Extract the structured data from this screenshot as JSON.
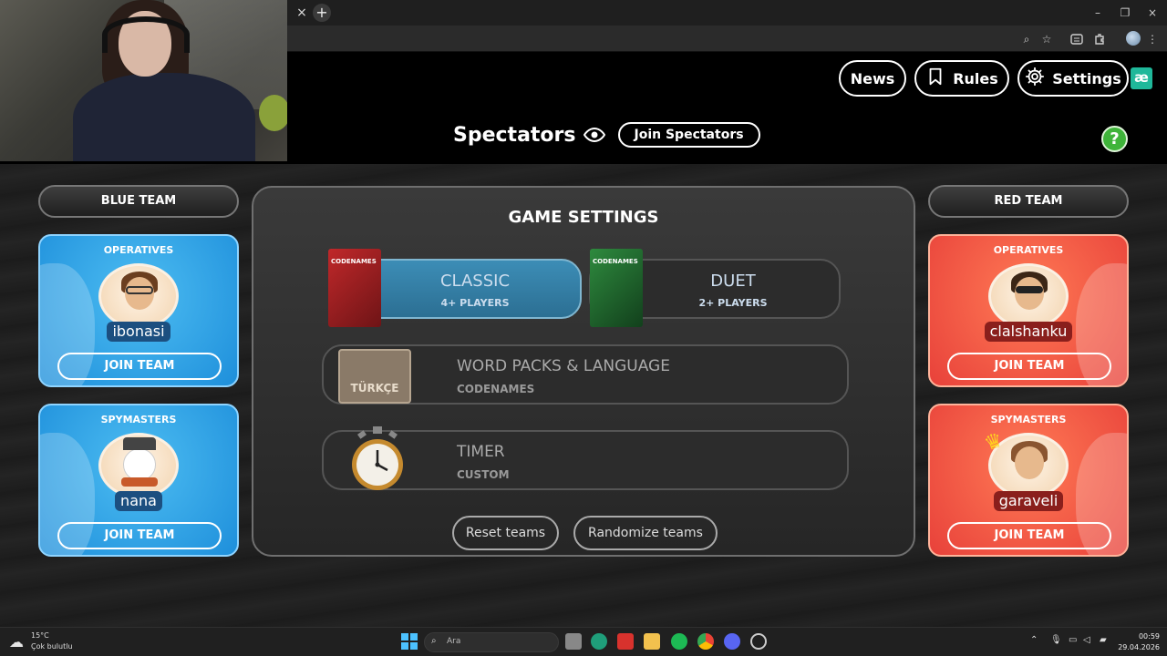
{
  "browser": {
    "tab_close": "×",
    "new_tab": "+",
    "win_min": "–",
    "win_restore": "❐",
    "win_close": "×",
    "zoom_icon": "⌕",
    "star_icon": "☆",
    "menu_icon": "⋮"
  },
  "nav": {
    "news": "News",
    "rules": "Rules",
    "settings": "Settings",
    "logo": "æ"
  },
  "spectators": {
    "title": "Spectators",
    "join": "Join Spectators"
  },
  "help": "?",
  "blue_team": {
    "header": "BLUE TEAM",
    "operatives": {
      "title": "OPERATIVES",
      "player": "ibonasi",
      "join": "JOIN TEAM"
    },
    "spymasters": {
      "title": "SPYMASTERS",
      "player": "nana",
      "join": "JOIN TEAM"
    }
  },
  "red_team": {
    "header": "RED TEAM",
    "operatives": {
      "title": "OPERATIVES",
      "player": "clalshanku",
      "join": "JOIN TEAM"
    },
    "spymasters": {
      "title": "SPYMASTERS",
      "player": "garaveli",
      "join": "JOIN TEAM"
    }
  },
  "game_settings": {
    "title": "GAME SETTINGS",
    "modes": [
      {
        "label": "CLASSIC",
        "sub": "4+ PLAYERS",
        "box": "CODENAMES",
        "selected": true
      },
      {
        "label": "DUET",
        "sub": "2+ PLAYERS",
        "box": "CODENAMES",
        "selected": false
      }
    ],
    "word_packs": {
      "label": "WORD PACKS & LANGUAGE",
      "sub": "CODENAMES",
      "box_text": "TÜRKÇE"
    },
    "timer": {
      "label": "TIMER",
      "sub": "CUSTOM"
    },
    "reset": "Reset teams",
    "randomize": "Randomize teams"
  },
  "taskbar": {
    "temp": "15°C",
    "weather": "Çok bulutlu",
    "search": "Ara",
    "time": "00:59",
    "date": "29.04.2026"
  },
  "colors": {
    "blue_card": "#2aa3e8",
    "red_card": "#f2553f",
    "classic_selected": "#3585ad",
    "help_green": "#3fb43a"
  }
}
